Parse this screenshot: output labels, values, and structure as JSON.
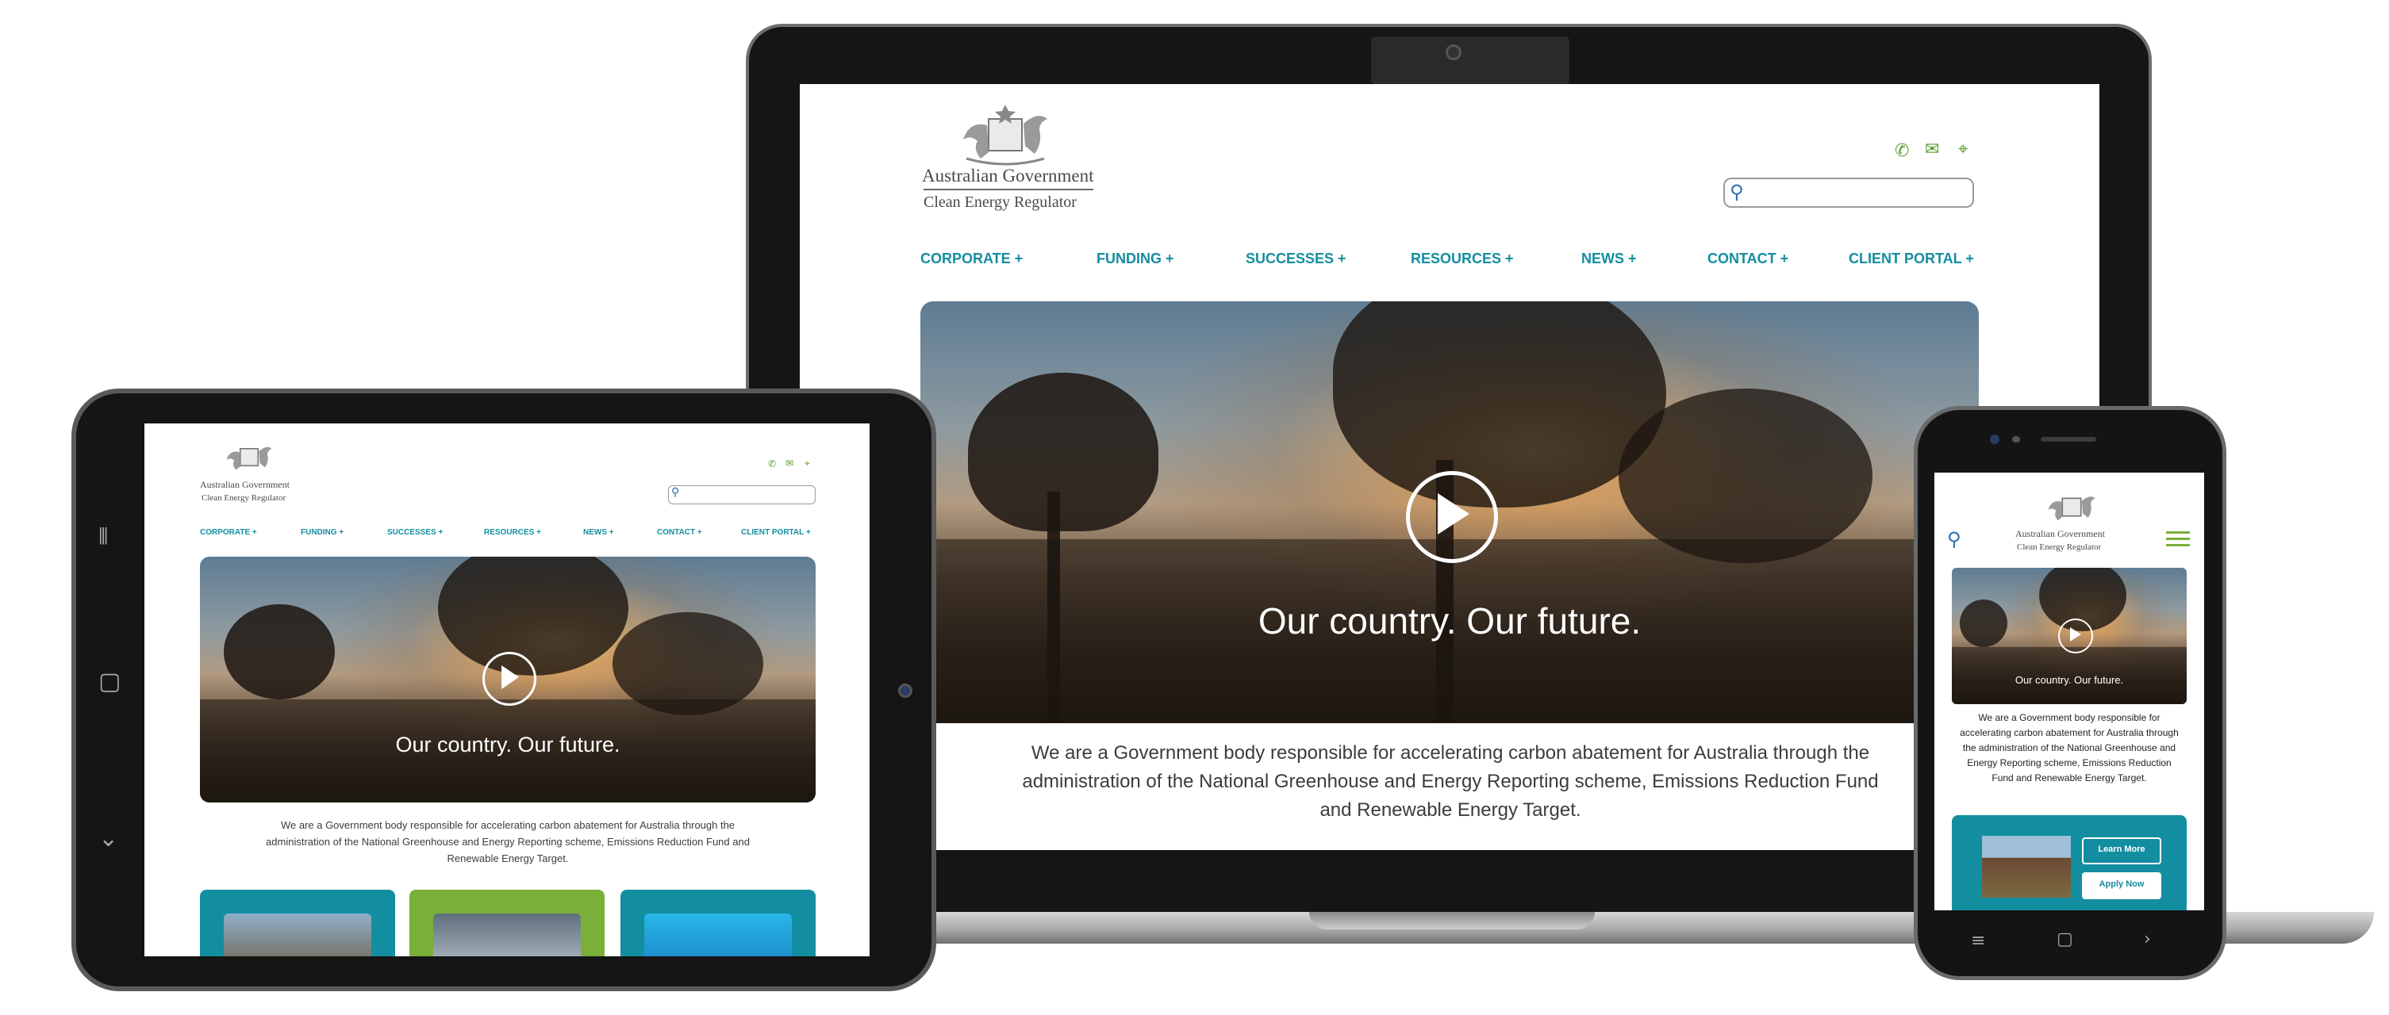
{
  "brand": {
    "gov_name": "Australian Government",
    "agency_name": "Clean Energy Regulator"
  },
  "nav": {
    "items": [
      "CORPORATE +",
      "FUNDING +",
      "SUCCESSES +",
      "RESOURCES +",
      "NEWS +",
      "CONTACT +",
      "CLIENT PORTAL +"
    ]
  },
  "header_icons": [
    "phone-icon",
    "mail-icon",
    "location-icon"
  ],
  "hero": {
    "caption": "Our country. Our future."
  },
  "intro": {
    "text": "We are a Government body responsible for accelerating carbon abatement for Australia through the administration of the National Greenhouse and Energy Reporting scheme, Emissions Reduction Fund and Renewable Energy Target."
  },
  "phone": {
    "learn_more": "Learn More",
    "apply_now": "Apply Now"
  },
  "colors": {
    "nav": "#138ea0",
    "icon": "#5a9b2b",
    "card_teal": "#138ea0",
    "card_green": "#7ab03a"
  }
}
